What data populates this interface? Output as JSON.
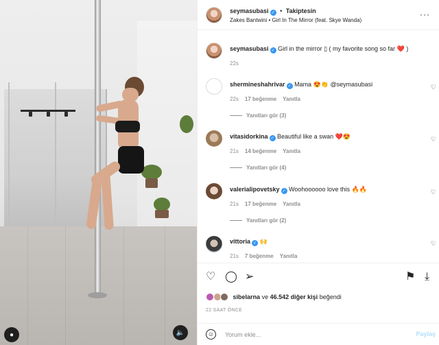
{
  "header": {
    "username": "seymasubasi",
    "separator": "•",
    "follow_status": "Takiptesin",
    "song": "Zakes Bantwini • Girl In The Mirror (feat. Skye Wanda)",
    "more_icon": "more-icon"
  },
  "caption": {
    "username": "seymasubasi",
    "text": "Girl in the mirror ▯ ( my favorite song so far ❤️ )",
    "time": "22s"
  },
  "comments": [
    {
      "username": "shermineshahrivar",
      "text": "Mama 😍👏 @seymasubasi",
      "time": "22s",
      "likes": "17 beğenme",
      "reply": "Yanıtla",
      "view_replies": "Yanıtları gör (3)"
    },
    {
      "username": "vitasidorkina",
      "text": "Beautiful like a swan ❤️😍",
      "time": "21s",
      "likes": "14 beğenme",
      "reply": "Yanıtla",
      "view_replies": "Yanıtları gör (4)"
    },
    {
      "username": "valerialipovetsky",
      "text": "Woohoooooo love this 🔥🔥",
      "time": "21s",
      "likes": "17 beğenme",
      "reply": "Yanıtla",
      "view_replies": "Yanıtları gör (2)"
    },
    {
      "username": "vittoria",
      "text": "🙌",
      "time": "21s",
      "likes": "7 beğenme",
      "reply": "Yanıtla"
    }
  ],
  "likes": {
    "user": "sibelarna",
    "connector": "ve",
    "count": "46.542 diğer kişi",
    "suffix": "beğendi"
  },
  "time_ago": "22 SAAT ÖNCE",
  "add_comment": {
    "placeholder": "Yorum ekle...",
    "post_label": "Paylaş"
  },
  "colors": {
    "verified": "#3897f0",
    "muted_text": "#8e8e8e",
    "post_disabled": "#b2dffc"
  }
}
